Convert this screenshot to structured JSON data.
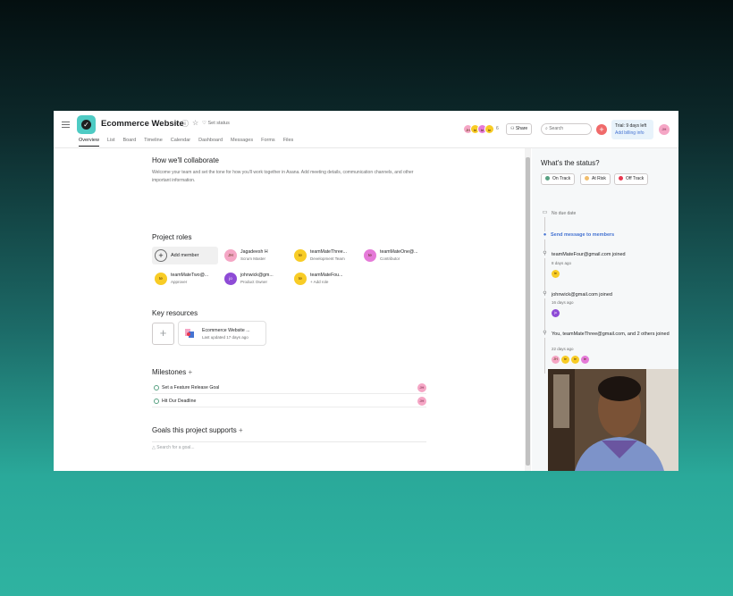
{
  "project": {
    "title": "Ecommerce Website",
    "set_status": "Set status"
  },
  "tabs": [
    "Overview",
    "List",
    "Board",
    "Timeline",
    "Calendar",
    "Dashboard",
    "Messages",
    "Forms",
    "Files"
  ],
  "header": {
    "avatar_initials": [
      "JH",
      "te",
      "te",
      "te"
    ],
    "avatar_count": "6",
    "share_label": "Share",
    "search_placeholder": "Search",
    "trial_label": "Trial: 9 days left",
    "billing_link": "Add billing info",
    "user_initials": "JH"
  },
  "collaborate": {
    "title": "How we'll collaborate",
    "description": "Welcome your team and set the tone for how you'll work together in Asana. Add meeting details, communication channels, and other important information."
  },
  "roles": {
    "title": "Project roles",
    "add_member": "Add member",
    "members": [
      {
        "initials": "JH",
        "name": "Jagadeesh H",
        "role": "Scrum Master",
        "color": "#f5a6c5"
      },
      {
        "initials": "te",
        "name": "teamMateThree...",
        "role": "Development Team",
        "color": "#f8cc26"
      },
      {
        "initials": "te",
        "name": "teamMateOne@...",
        "role": "Contributor",
        "color": "#e57ad8"
      },
      {
        "initials": "te",
        "name": "teamMateTwo@...",
        "role": "Approver",
        "color": "#f8cc26"
      },
      {
        "initials": "jo",
        "name": "johnwick@gm...",
        "role": "Product Owner",
        "color": "#8e4bd6"
      },
      {
        "initials": "te",
        "name": "teamMateFou...",
        "role": "+ Add role",
        "color": "#f8cc26"
      }
    ]
  },
  "resources": {
    "title": "Key resources",
    "card_name": "Ecommerce Website ...",
    "card_updated": "Last updated 17 days ago"
  },
  "milestones": {
    "title": "Milestones",
    "items": [
      {
        "label": "Set a Feature Release Goal",
        "assignee": "JH"
      },
      {
        "label": "Hit Our Deadline",
        "assignee": "JH"
      }
    ]
  },
  "goals": {
    "title": "Goals this project supports",
    "search_placeholder": "Search for a goal..."
  },
  "status_panel": {
    "question": "What's the status?",
    "buttons": [
      {
        "label": "On Track",
        "color": "#58a182"
      },
      {
        "label": "At Risk",
        "color": "#f1bd6c"
      },
      {
        "label": "Off Track",
        "color": "#e8384f"
      }
    ],
    "no_due_date": "No due date",
    "send_message": "Send message to members",
    "activity": [
      {
        "text": "teamMateFour@gmail.com joined",
        "time": "8 days ago"
      },
      {
        "text": "johnwick@gmail.com joined",
        "time": "16 days ago"
      },
      {
        "text": "You, teamMateThree@gmail.com, and 2 others joined",
        "time": "22 days ago"
      }
    ]
  }
}
